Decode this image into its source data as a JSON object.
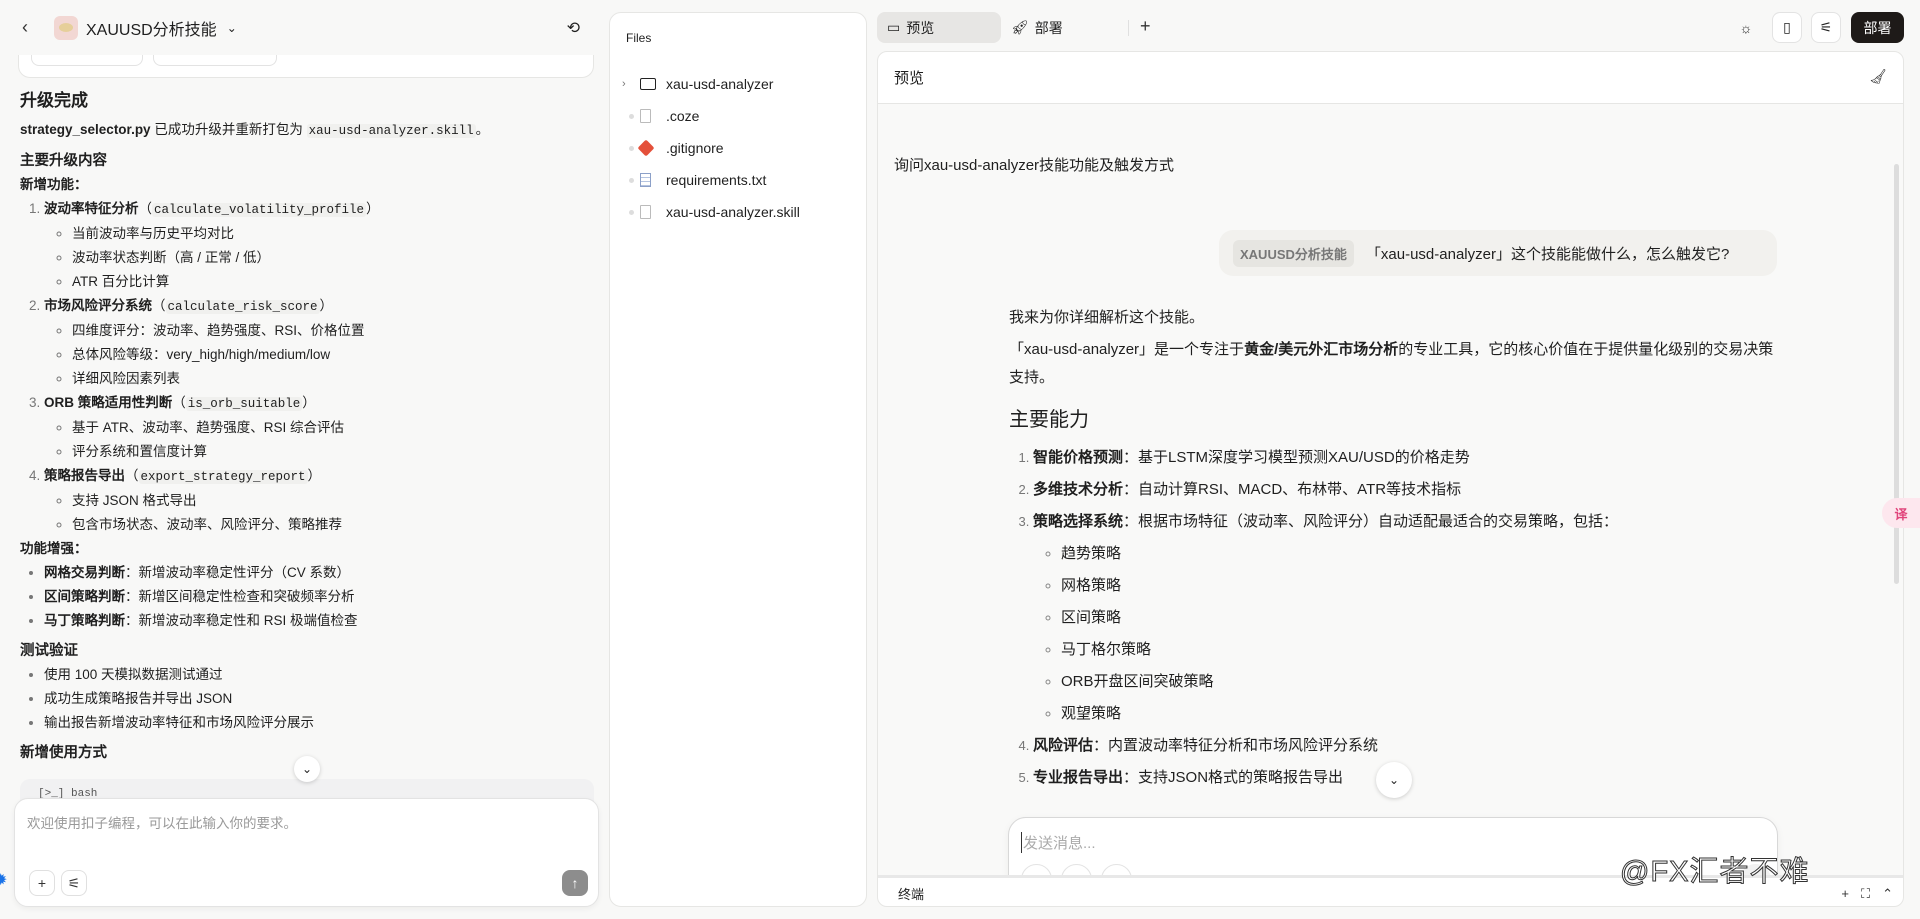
{
  "left": {
    "back_icon": "chevron-left-icon",
    "title": "XAUUSD分析技能",
    "history_icon": "history-icon",
    "chat": {
      "heading": "升级完成",
      "intro_bold": "strategy_selector.py",
      "intro_text": " 已成功升级并重新打包为 ",
      "intro_code": "xau-usd-analyzer.skill",
      "intro_end": "。",
      "section1": "主要升级内容",
      "new_features_label": "新增功能：",
      "features": [
        {
          "title": "波动率特征分析",
          "code": "calculate_volatility_profile",
          "subs": [
            "当前波动率与历史平均对比",
            "波动率状态判断（高 / 正常 / 低）",
            "ATR 百分比计算"
          ]
        },
        {
          "title": "市场风险评分系统",
          "code": "calculate_risk_score",
          "subs": [
            "四维度评分：波动率、趋势强度、RSI、价格位置",
            "总体风险等级：very_high/high/medium/low",
            "详细风险因素列表"
          ]
        },
        {
          "title": "ORB 策略适用性判断",
          "code": "is_orb_suitable",
          "subs": [
            "基于 ATR、波动率、趋势强度、RSI 综合评估",
            "评分系统和置信度计算"
          ]
        },
        {
          "title": "策略报告导出",
          "code": "export_strategy_report",
          "subs": [
            "支持 JSON 格式导出",
            "包含市场状态、波动率、风险评分、策略推荐"
          ]
        }
      ],
      "enhance_label": "功能增强：",
      "enhancements": [
        {
          "title": "网格交易判断",
          "text": "：新增波动率稳定性评分（CV 系数）"
        },
        {
          "title": "区间策略判断",
          "text": "：新增区间稳定性检查和突破频率分析"
        },
        {
          "title": "马丁策略判断",
          "text": "：新增波动率稳定性和 RSI 极端值检查"
        }
      ],
      "section2": "测试验证",
      "tests": [
        "使用 100 天模拟数据测试通过",
        "成功生成策略报告并导出 JSON",
        "输出报告新增波动率特征和市场风险评分展示"
      ],
      "section3": "新增使用方式",
      "code_lang": "[>_] bash"
    },
    "input_placeholder": "欢迎使用扣子编程，可以在此输入你的要求。"
  },
  "files": {
    "title": "Files",
    "items": [
      {
        "name": "xau-usd-analyzer",
        "type": "folder"
      },
      {
        "name": ".coze",
        "type": "file"
      },
      {
        "name": ".gitignore",
        "type": "git"
      },
      {
        "name": "requirements.txt",
        "type": "text"
      },
      {
        "name": "xau-usd-analyzer.skill",
        "type": "file"
      }
    ]
  },
  "tabs": {
    "preview": "预览",
    "deploy": "部署",
    "add": "+"
  },
  "toolbar": {
    "deploy_button": "部署"
  },
  "preview": {
    "header": "预览",
    "conversation_title": "询问xau-usd-analyzer技能功能及触发方式",
    "user_tag": "XAUUSD分析技能",
    "user_message": "「xau-usd-analyzer」这个技能能做什么，怎么触发它?",
    "answer": {
      "p1": "我来为你详细解析这个技能。",
      "p2_a": "「xau-usd-analyzer」是一个专注于",
      "p2_bold": "黄金/美元外汇市场分析",
      "p2_b": "的专业工具，它的核心价值在于提供量化级别的交易决策支持。",
      "heading": "主要能力",
      "items": [
        {
          "title": "智能价格预测",
          "text": "：基于LSTM深度学习模型预测XAU/USD的价格走势"
        },
        {
          "title": "多维技术分析",
          "text": "：自动计算RSI、MACD、布林带、ATR等技术指标"
        },
        {
          "title": "策略选择系统",
          "text": "：根据市场特征（波动率、风险评分）自动适配最适合的交易策略，包括："
        },
        {
          "title": "风险评估",
          "text": "：内置波动率特征分析和市场风险评分系统"
        },
        {
          "title": "专业报告导出",
          "text": "：支持JSON格式的策略报告导出"
        }
      ],
      "strategies": [
        "趋势策略",
        "网格策略",
        "区间策略",
        "马丁格尔策略",
        "ORB开盘区间突破策略",
        "观望策略"
      ]
    },
    "input_placeholder": "发送消息...",
    "terminal_label": "终端"
  },
  "watermark": "@FX汇者不难",
  "translate_badge": "译"
}
